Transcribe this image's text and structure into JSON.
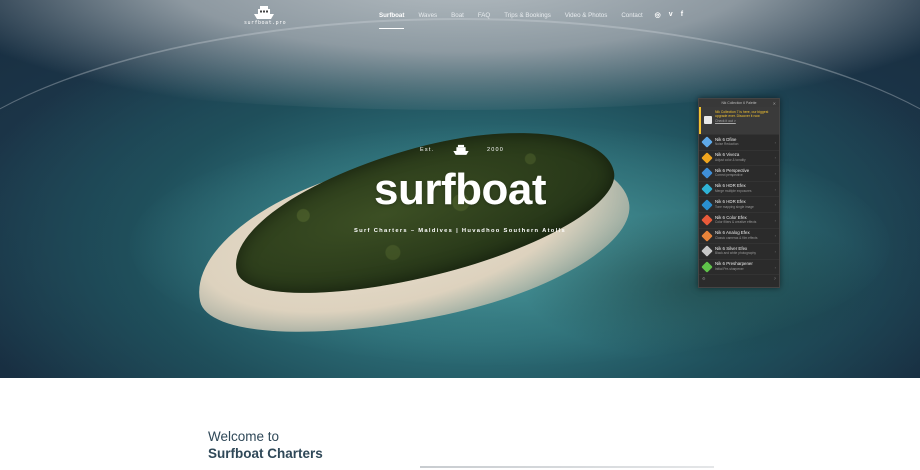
{
  "header": {
    "logo_text": "surfboat.pro",
    "nav": [
      {
        "label": "Surfboat",
        "active": true
      },
      {
        "label": "Waves",
        "active": false
      },
      {
        "label": "Boat",
        "active": false
      },
      {
        "label": "FAQ",
        "active": false
      },
      {
        "label": "Trips & Bookings",
        "active": false
      },
      {
        "label": "Video & Photos",
        "active": false
      },
      {
        "label": "Contact",
        "active": false
      }
    ],
    "social": [
      {
        "icon": "instagram-icon",
        "glyph": "◎"
      },
      {
        "icon": "vimeo-icon",
        "glyph": "v"
      },
      {
        "icon": "facebook-icon",
        "glyph": "f"
      }
    ]
  },
  "hero": {
    "est_label": "Est.",
    "est_year": "2000",
    "title": "surfboat",
    "subtitle": "Surf Charters – Maldives | Huvadhoo Southern Atolls"
  },
  "nik_panel": {
    "title": "Nik Collection 6 Palette",
    "notice": "Nik Collection 7 is here, our biggest upgrade ever. Discover it now",
    "notice_link": "Check it out >",
    "items": [
      {
        "name": "Nik 6 Dfine",
        "desc": "Noise Reduction",
        "color": "#5fa9e8"
      },
      {
        "name": "Nik 6 Viveza",
        "desc": "Adjust color & tonality",
        "color": "#f0a51e"
      },
      {
        "name": "Nik 6 Perspective",
        "desc": "Correct perspective",
        "color": "#3f8fd8"
      },
      {
        "name": "Nik 6 HDR Efex",
        "desc": "Merge multiple exposures",
        "color": "#2fb3d6"
      },
      {
        "name": "Nik 6 HDR Efex",
        "desc": "Tone mapping single image",
        "color": "#2a8fd0"
      },
      {
        "name": "Nik 6 Color Efex",
        "desc": "Color filters & creative effects",
        "color": "#e85a3a"
      },
      {
        "name": "Nik 6 Analog Efex",
        "desc": "Classic cameras & film effects",
        "color": "#e8843a"
      },
      {
        "name": "Nik 6 Silver Efex",
        "desc": "Black and white photography",
        "color": "#c8c8c8"
      },
      {
        "name": "Nik 6 Presharpener",
        "desc": "Initial Pre-sharpener",
        "color": "#5fc24a"
      }
    ]
  },
  "welcome": {
    "line1": "Welcome to",
    "line2": "Surfboat Charters"
  }
}
